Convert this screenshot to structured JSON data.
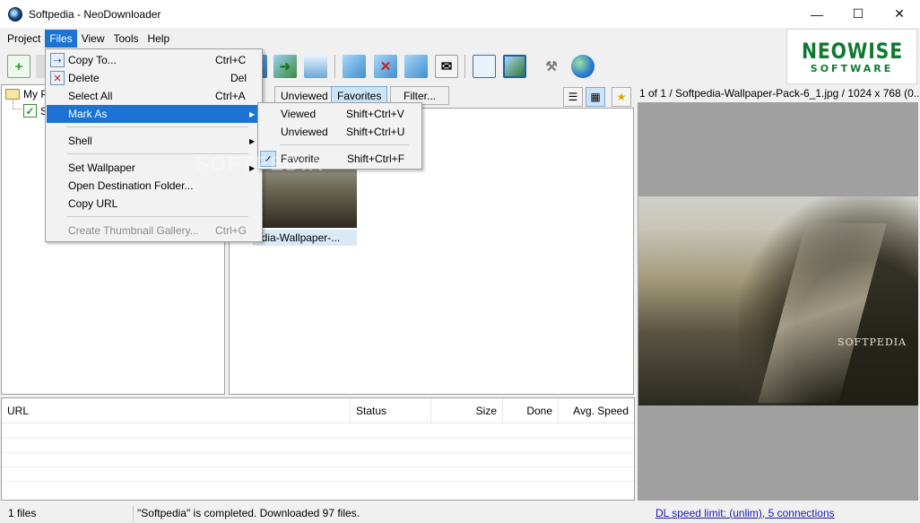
{
  "window": {
    "title": "Softpedia - NeoDownloader",
    "minimize_glyph": "—",
    "maximize_glyph": "☐",
    "close_glyph": "✕"
  },
  "menubar": {
    "items": [
      "Project",
      "Files",
      "View",
      "Tools",
      "Help"
    ],
    "active": "Files"
  },
  "logo": {
    "line1": "NEOWISE",
    "line2": "SOFTWARE"
  },
  "toolbar": {
    "icons": [
      "add-project-icon",
      "open-icon",
      "download-images-icon",
      "next-image-icon",
      "slideshow-icon",
      "view-image-icon",
      "delete-image-icon",
      "zoom-image-icon",
      "email-icon",
      "fullscreen-icon",
      "fit-screen-icon",
      "settings-tools-icon",
      "update-web-icon"
    ]
  },
  "tree": {
    "root_label": "My P",
    "child_label": "S"
  },
  "gallery": {
    "tabs": [
      "Unviewed",
      "Favorites",
      "Filter..."
    ],
    "selected_tab": "Favorites",
    "thumb_label": "edia-Wallpaper-..."
  },
  "preview": {
    "header": "1 of 1 / Softpedia-Wallpaper-Pack-6_1.jpg / 1024 x 768 (0....",
    "brand": "SOFTPEDIA"
  },
  "downloads": {
    "columns": [
      "URL",
      "Status",
      "Size",
      "Done",
      "Avg. Speed"
    ]
  },
  "statusbar": {
    "file_count": "1 files",
    "message": "\"Softpedia\" is completed. Downloaded 97 files.",
    "speed_link": "DL speed limit: (unlim), 5 connections"
  },
  "files_menu": {
    "items": [
      {
        "label": "Copy To...",
        "shortcut": "Ctrl+C"
      },
      {
        "label": "Delete",
        "shortcut": "Del"
      },
      {
        "label": "Select All",
        "shortcut": "Ctrl+A"
      },
      {
        "label": "Mark As",
        "shortcut": ""
      },
      {
        "label": "Shell",
        "shortcut": ""
      },
      {
        "label": "Set Wallpaper",
        "shortcut": ""
      },
      {
        "label": "Open Destination Folder...",
        "shortcut": ""
      },
      {
        "label": "Copy URL",
        "shortcut": ""
      },
      {
        "label": "Create Thumbnail Gallery...",
        "shortcut": "Ctrl+G"
      }
    ]
  },
  "mark_as_menu": {
    "items": [
      {
        "label": "Viewed",
        "shortcut": "Shift+Ctrl+V"
      },
      {
        "label": "Unviewed",
        "shortcut": "Shift+Ctrl+U"
      },
      {
        "label": "Favorite",
        "shortcut": "Shift+Ctrl+F",
        "checked": true
      }
    ]
  },
  "watermark": "SOFTPEDIA",
  "colors": {
    "menu_highlight": "#1b74d3",
    "logo_green": "#0f7a2f",
    "link": "#1a1aa8"
  }
}
